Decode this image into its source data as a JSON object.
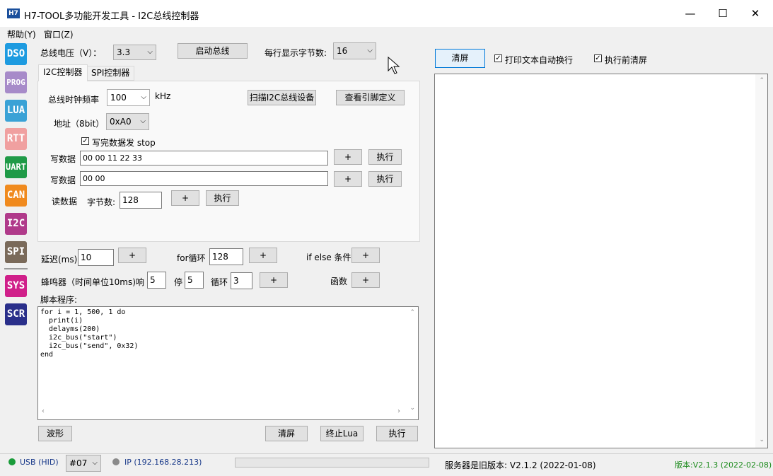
{
  "window": {
    "title": "H7-TOOL多功能开发工具 - I2C总线控制器",
    "icon_text": "H7",
    "minimize": "—",
    "maximize": "☐",
    "close": "✕"
  },
  "menu": {
    "help": "帮助(Y)",
    "window": "窗口(Z)"
  },
  "sidebar": [
    "DSO",
    "PROG",
    "LUA",
    "RTT",
    "UART",
    "CAN",
    "I2C",
    "SPI",
    "SYS",
    "SCR"
  ],
  "top": {
    "voltage_label": "总线电压（V）：",
    "voltage_value": "3.3",
    "start_bus": "启动总线",
    "bytes_per_line_label": "每行显示字节数:",
    "bytes_per_line_value": "16"
  },
  "tabs": {
    "i2c": "I2C控制器",
    "spi": "SPI控制器"
  },
  "i2c": {
    "clock_label": "总线时钟频率",
    "clock_value": "100",
    "clock_unit": "kHz",
    "scan_button": "扫描I2C总线设备",
    "pin_button": "查看引脚定义",
    "addr_label": "地址（8bit）",
    "addr_value": "0xA0",
    "stop_checkbox": "写完数据发 stop",
    "write1_label": "写数据",
    "write1_value": "00 00 11 22 33",
    "write2_label": "写数据",
    "write2_value": "00 00",
    "read_label": "读数据",
    "read_bytes_label": "字节数:",
    "read_bytes_value": "128",
    "plus": "+",
    "execute": "执行"
  },
  "script_tools": {
    "delay_label": "延迟(ms)",
    "delay_value": "10",
    "for_label": "for循环",
    "for_value": "128",
    "ifelse_label": "if else 条件",
    "beep_label": "蜂鸣器（时间单位10ms)响",
    "beep_on_value": "5",
    "stop_label": "停",
    "beep_off_value": "5",
    "loop_label": "循环",
    "loop_value": "3",
    "func_label": "函数",
    "plus": "+"
  },
  "script": {
    "label": "脚本程序:",
    "code": "for i = 1, 500, 1 do\n  print(i)\n  delayms(200)\n  i2c_bus(\"start\")\n  i2c_bus(\"send\", 0x32)\nend",
    "waveform": "波形",
    "clear": "清屏",
    "stop_lua": "终止Lua",
    "execute": "执行"
  },
  "right": {
    "clear": "清屏",
    "autowrap": "打印文本自动换行",
    "clear_before": "执行前清屏"
  },
  "status": {
    "usb": "USB (HID)",
    "device": "#07",
    "ip": "IP (192.168.28.213)",
    "server_msg": "服务器是旧版本: V2.1.2 (2022-01-08)",
    "version": "版本:V2.1.3 (2022-02-08)"
  }
}
